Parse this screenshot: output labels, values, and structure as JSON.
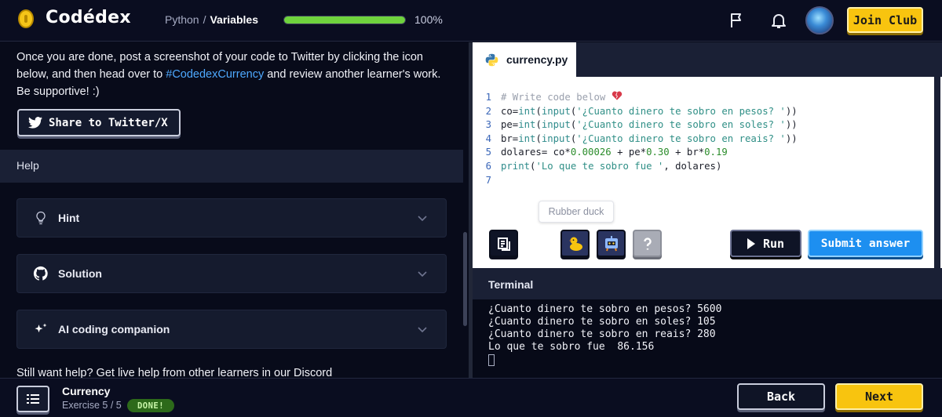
{
  "app": {
    "logo_text": "Codédex",
    "breadcrumb": {
      "course": "Python",
      "separator": "/",
      "chapter": "Variables"
    },
    "progress": {
      "percent": 100,
      "label": "100%"
    },
    "icons": {
      "flag": "flag-icon",
      "bell": "bell-icon"
    },
    "join_club_label": "Join Club",
    "colors": {
      "accent_yellow": "#f8c40f",
      "accent_blue": "#1d8ff0",
      "progress_green": "#6fd33d",
      "link_blue": "#4ea9ff"
    }
  },
  "left": {
    "description_before": "Once you are done, post a screenshot of your code to Twitter by clicking the icon below, and then head over to ",
    "hashtag": "#CodedexCurrency",
    "description_after": " and review another learner's work. Be supportive! :)",
    "share_button": "Share to Twitter/X",
    "help_label": "Help",
    "accordions": [
      {
        "label": "Hint",
        "icon": "lightbulb-icon"
      },
      {
        "label": "Solution",
        "icon": "github-icon"
      },
      {
        "label": "AI coding companion",
        "icon": "sparkle-icon"
      }
    ],
    "still_help": "Still want help? Get live help from other learners in our Discord"
  },
  "editor": {
    "tab_label": "currency.py",
    "line_numbers": [
      "1",
      "2",
      "3",
      "4",
      "5",
      "6",
      "7"
    ],
    "code": {
      "l1_comment": "# Write code below ",
      "l2_var": "co=",
      "l2_fn1": "int",
      "l2_p1": "(",
      "l2_fn2": "input",
      "l2_p2": "(",
      "l2_str": "'¿Cuanto dinero te sobro en pesos? '",
      "l2_close": "))",
      "l3_var": "pe=",
      "l3_fn1": "int",
      "l3_p1": "(",
      "l3_fn2": "input",
      "l3_p2": "(",
      "l3_str": "'¿Cuanto dinero te sobro en soles? '",
      "l3_close": "))",
      "l4_var": "br=",
      "l4_fn1": "int",
      "l4_p1": "(",
      "l4_fn2": "input",
      "l4_p2": "(",
      "l4_str": "'¿Cuanto dinero te sobro en reais? '",
      "l4_close": "))",
      "l5_a": "dolares= co*",
      "l5_n1": "0.00026",
      "l5_b": " + pe*",
      "l5_n2": "0.30",
      "l5_c": " + br*",
      "l5_n3": "0.19",
      "l6_fn": "print",
      "l6_p": "(",
      "l6_str": "'Lo que te sobro fue '",
      "l6_rest": ", dolares)"
    },
    "tooltip": "Rubber duck",
    "tools": [
      {
        "name": "copy-button",
        "icon": "copy-icon",
        "color": "#0f1426"
      },
      {
        "name": "rubber-duck-button",
        "icon": "duck-icon",
        "color": "#2a3460"
      },
      {
        "name": "ai-helper-button",
        "icon": "robot-icon",
        "color": "#2a3460"
      },
      {
        "name": "help-button",
        "icon": "question-icon",
        "color": "#a9acb6"
      }
    ],
    "run_label": "Run",
    "submit_label": "Submit answer"
  },
  "terminal": {
    "title": "Terminal",
    "lines": [
      "¿Cuanto dinero te sobro en pesos? 5600",
      "¿Cuanto dinero te sobro en soles? 105",
      "¿Cuanto dinero te sobro en reais? 280",
      "Lo que te sobro fue  86.156"
    ]
  },
  "bottom": {
    "exercise_title": "Currency",
    "exercise_count": "Exercise 5 / 5",
    "done_badge": "DONE!",
    "back_label": "Back",
    "next_label": "Next"
  }
}
